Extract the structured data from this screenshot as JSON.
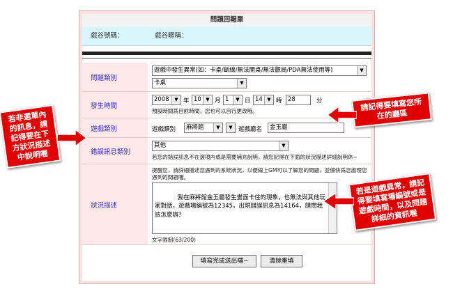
{
  "form": {
    "title": "問題回報單",
    "game_number_label": "戲谷號碼：",
    "game_account_label": "戲谷暱稱："
  },
  "rows": {
    "problem_type": {
      "label": "問題類別",
      "select1": "遊戲中發生異常(如：卡桌/斷線/無法開桌/無法觀局/PDA無法使用等)",
      "select2": "卡桌"
    },
    "time": {
      "label": "發生時間",
      "year": "2008",
      "year_unit": "年",
      "month": "10",
      "month_unit": "月",
      "day": "1",
      "day_unit": "日",
      "hour": "14",
      "hour_unit": "時",
      "minute": "28",
      "minute_unit": "分",
      "note": "預設時間爲目前時間，您也可以自行更改哦。"
    },
    "game_type": {
      "label": "遊戲類別",
      "category_label": "遊戲類別",
      "category_value": "麻將館",
      "hall_label": "遊戲廳名",
      "hall_value": "金玉廳"
    },
    "error_type": {
      "label": "錯誤訊息類別",
      "select": "其他",
      "note": "若您的錯誤訊息不在選項內或是需要補充說明，請您記得在下面的狀況描述詳細說明休~"
    },
    "description": {
      "label": "狀況描述",
      "hint": "提醒您，請詳細描述您遇到的系統狀況，以便線上GM可以了解您的問題，並儘快爲您處理您遇到的問題喔。",
      "text": "我在麻將館金玉廳發生畫面卡住的現象，也無法與其他玩家對話，遊戲場編號為12345，出現錯誤訊息為14164，請問我該怎麼辦？",
      "limit": "文字限制(63/200)"
    }
  },
  "buttons": {
    "submit": "填寫完成送出囉~",
    "reset": "清除重填"
  },
  "callouts": {
    "left": "若非選單內的訊息，請記得要在下方狀況描述中說明喔",
    "right_top": "請記得要填寫您所在的廳區",
    "right_bottom": "若是遊戲異常，請記得要填寫場編號或是遊戲時間，以及問題詳細的資訊喔"
  },
  "colors": {
    "callout_red": "#e00000",
    "label_blue": "#2b2bcc",
    "label_bg": "#ffe8e8",
    "info_bar": "#d8f6fb"
  }
}
